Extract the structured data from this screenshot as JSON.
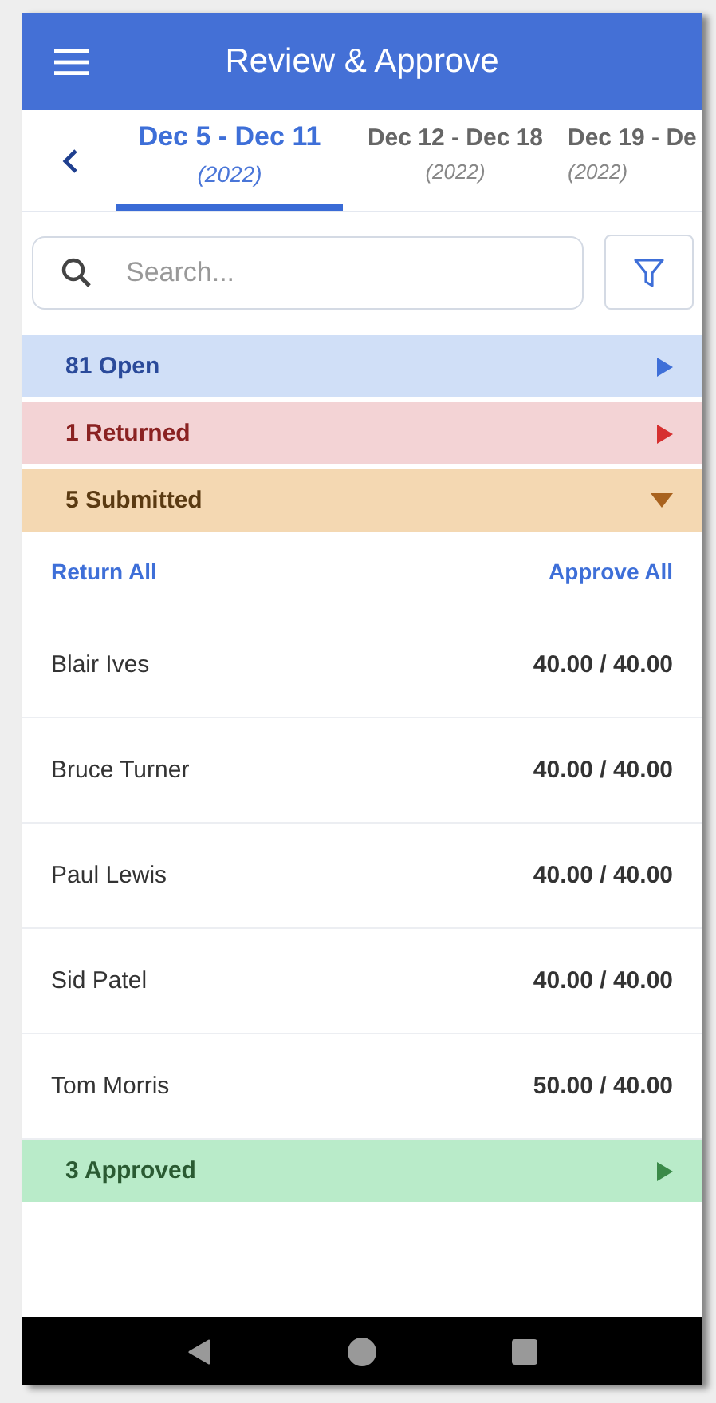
{
  "header": {
    "title": "Review & Approve"
  },
  "weeks": [
    {
      "range": "Dec 5 - Dec 11",
      "year": "(2022)",
      "selected": true
    },
    {
      "range": "Dec 12 - Dec 18",
      "year": "(2022)",
      "selected": false
    },
    {
      "range": "Dec 19 - De",
      "year": "(2022)",
      "selected": false
    }
  ],
  "search": {
    "placeholder": "Search..."
  },
  "groups": [
    {
      "kind": "open",
      "label": "81 Open",
      "expanded": false
    },
    {
      "kind": "returned",
      "label": "1 Returned",
      "expanded": false
    },
    {
      "kind": "submitted",
      "label": "5 Submitted",
      "expanded": true,
      "actions": [
        "Return All",
        "Approve All"
      ],
      "people": [
        {
          "name": "Blair Ives",
          "hours": "40.00 / 40.00"
        },
        {
          "name": "Bruce Turner",
          "hours": "40.00 / 40.00"
        },
        {
          "name": "Paul Lewis",
          "hours": "40.00 / 40.00"
        },
        {
          "name": "Sid Patel",
          "hours": "40.00 / 40.00"
        },
        {
          "name": "Tom Morris",
          "hours": "50.00 / 40.00"
        }
      ]
    },
    {
      "kind": "approved",
      "label": "3 Approved",
      "expanded": false
    }
  ]
}
